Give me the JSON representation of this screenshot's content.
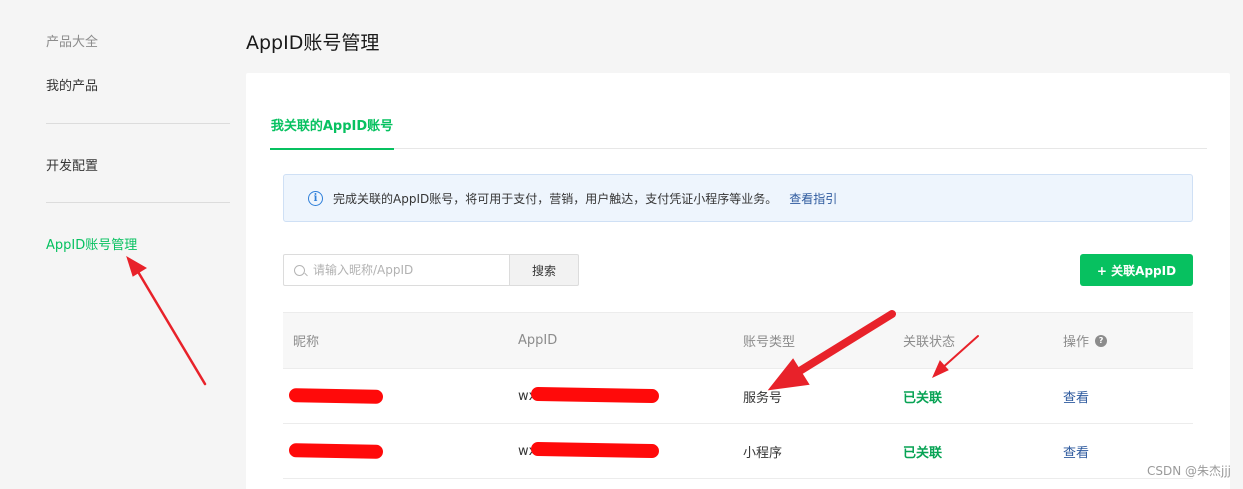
{
  "sidebar": {
    "header": "产品大全",
    "items": [
      {
        "label": "我的产品"
      },
      {
        "label": "开发配置"
      },
      {
        "label": "AppID账号管理",
        "active": true
      }
    ]
  },
  "page": {
    "title": "AppID账号管理"
  },
  "tabs": [
    {
      "label": "我关联的AppID账号",
      "active": true
    }
  ],
  "notice": {
    "icon": "info-icon",
    "text": "完成关联的AppID账号，将可用于支付，营销，用户触达，支付凭证小程序等业务。",
    "link": "查看指引"
  },
  "search": {
    "placeholder": "请输入昵称/AppID",
    "button": "搜索",
    "value": ""
  },
  "add_button": "+ 关联AppID",
  "table": {
    "headers": [
      "昵称",
      "AppID",
      "账号类型",
      "关联状态",
      "操作"
    ],
    "rows": [
      {
        "nickname": "",
        "appid_prefix": "wx",
        "type": "服务号",
        "status": "已关联",
        "action": "查看"
      },
      {
        "nickname": "",
        "appid_prefix": "wx",
        "type": "小程序",
        "status": "已关联",
        "action": "查看"
      }
    ]
  },
  "colors": {
    "accent": "#07c160",
    "link": "#2e5a9e",
    "annotation": "#e8222a"
  },
  "watermark": "CSDN @朱杰jjj"
}
